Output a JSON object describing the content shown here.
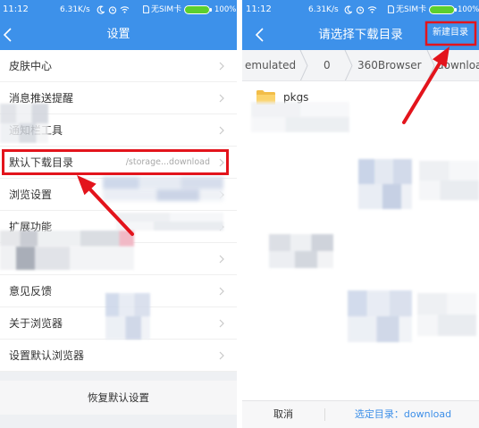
{
  "left_screen": {
    "status_bar": {
      "time": "11:12",
      "net_speed": "6.31K/s",
      "sim_status": "无SIM卡",
      "battery": "100%",
      "icons": [
        "moon-icon",
        "alarm-clock-icon",
        "wifi-icon",
        "sim-card-icon",
        "battery-icon"
      ]
    },
    "header": {
      "title": "设置",
      "back_icon": "back-arrow-icon"
    },
    "settings_items": [
      {
        "label": "皮肤中心"
      },
      {
        "label": "消息推送提醒"
      },
      {
        "label": "通知栏工具"
      },
      {
        "label": "默认下载目录",
        "value": "/storage...download"
      },
      {
        "label": "浏览设置"
      },
      {
        "label": "扩展功能"
      },
      {
        "label": "意见反馈"
      },
      {
        "label": "关于浏览器"
      },
      {
        "label": "设置默认浏览器"
      }
    ],
    "reset_button": "恢复默认设置"
  },
  "right_screen": {
    "status_bar": {
      "time": "11:12",
      "net_speed": "6.31K/s",
      "sim_status": "无SIM卡",
      "battery": "100%"
    },
    "header": {
      "title": "请选择下载目录",
      "new_folder_button": "新建目录",
      "back_icon": "back-arrow-icon"
    },
    "breadcrumbs": [
      "emulated",
      "0",
      "360Browser",
      "download"
    ],
    "folders": [
      {
        "name": "pkgs",
        "icon": "folder-icon"
      }
    ],
    "footer": {
      "cancel_button": "取消",
      "selected_directory": "选定目录：download"
    }
  },
  "annotations": {
    "highlight_color": "#e3141c"
  },
  "theme": {
    "accent": "#3d91ea",
    "battery_color": "#5ccf2e",
    "link_color": "#3d8fe8"
  }
}
